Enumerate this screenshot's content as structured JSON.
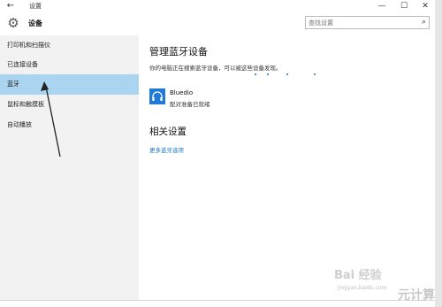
{
  "window": {
    "title": "设置",
    "back_icon": "←",
    "minimize_icon": "—",
    "maximize_icon": "☐",
    "close_icon": "✕"
  },
  "header": {
    "app_title": "设备",
    "gear_icon": "⚙",
    "search_placeholder": "查找设置",
    "search_icon": "⌕"
  },
  "sidebar": {
    "items": [
      {
        "label": "打印机和扫描仪"
      },
      {
        "label": "已连接设备"
      },
      {
        "label": "蓝牙"
      },
      {
        "label": "鼠标和触摸板"
      },
      {
        "label": "自动播放"
      }
    ],
    "active_index": 2
  },
  "main": {
    "title": "管理蓝牙设备",
    "description": "你的电脑正在搜索蓝牙设备，可以被这些设备发现。",
    "device": {
      "name": "Bluedio",
      "status": "配对准备已就绪"
    },
    "related_title": "相关设置",
    "more_link": "更多蓝牙选项"
  },
  "watermark": {
    "brand": "Bai 经验",
    "url": "jingyan.baidu.com",
    "corner": "元计算"
  },
  "colors": {
    "accent": "#1a73c8",
    "active_nav": "#aad4f0",
    "sidebar_bg": "#f2f2f2",
    "device_icon_bg": "#1e7ad6"
  }
}
